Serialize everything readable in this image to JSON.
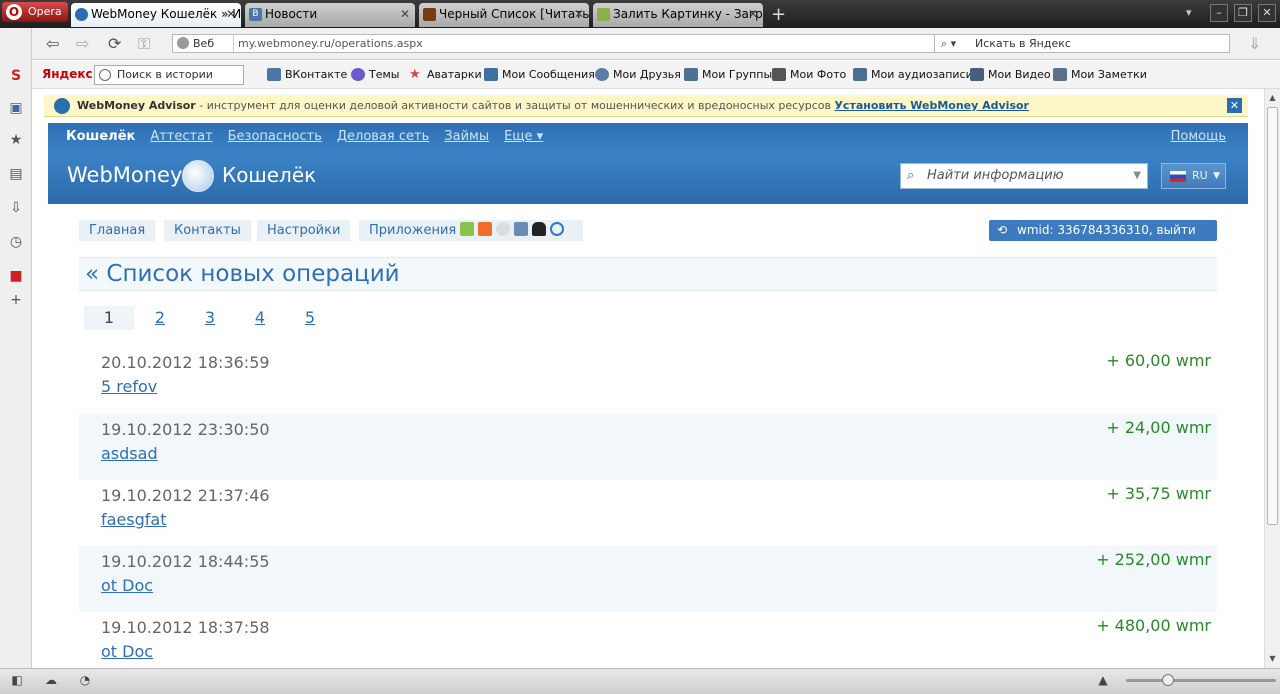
{
  "browser": {
    "opera_label": "Opera",
    "tabs": [
      {
        "label": "WebMoney Кошелёк » И...",
        "active": true
      },
      {
        "label": "Новости",
        "active": false
      },
      {
        "label": "Черный Список [Читать...",
        "active": false
      },
      {
        "label": "Залить Картинку - Загр...",
        "active": false
      }
    ],
    "close_glyph": "✕",
    "newtab_glyph": "+",
    "address": {
      "prefix": "Веб",
      "url": "my.webmoney.ru/operations.aspx"
    },
    "search_placeholder": "Искать в Яндекс",
    "yandex": "Яндекс",
    "history_placeholder": "Поиск в истории",
    "bookmarks": [
      "ВКонтакте",
      "Темы",
      "Аватарки",
      "Мои Сообщения",
      "Мои Друзья",
      "Мои Группы",
      "Мои Фото",
      "Мои аудиозаписи",
      "Мои Видео",
      "Мои Заметки"
    ]
  },
  "advisor": {
    "brand": "WebMoney Advisor",
    "text": " - инструмент для оценки деловой активности сайтов и защиты от мошеннических и вредоносных ресурсов ",
    "link": "Установить WebMoney Advisor",
    "close": "✕"
  },
  "header": {
    "nav": [
      "Кошелёк",
      "Аттестат",
      "Безопасность",
      "Деловая сеть",
      "Займы",
      "Еще ▾"
    ],
    "help": "Помощь",
    "brand": "WebMoney",
    "brand_sub": "Кошелёк",
    "search_placeholder": "Найти информацию",
    "lang": "RU"
  },
  "menu": {
    "items": [
      "Главная",
      "Контакты",
      "Настройки",
      "Приложения"
    ],
    "wmid": "wmid: 336784336310, выйти"
  },
  "page_title": "« Список новых операций",
  "pager": [
    "1",
    "2",
    "3",
    "4",
    "5"
  ],
  "operations": [
    {
      "date": "20.10.2012 18:36:59",
      "desc": "5 refov",
      "amount": "+ 60,00 wmr"
    },
    {
      "date": "19.10.2012 23:30:50",
      "desc": "asdsad",
      "amount": "+ 24,00 wmr"
    },
    {
      "date": "19.10.2012 21:37:46",
      "desc": "faesgfat",
      "amount": "+ 35,75 wmr"
    },
    {
      "date": "19.10.2012 18:44:55",
      "desc": "ot Doc",
      "amount": "+ 252,00 wmr"
    },
    {
      "date": "19.10.2012 18:37:58",
      "desc": "ot Doc",
      "amount": "+ 480,00 wmr"
    }
  ],
  "colors": {
    "brand_blue": "#2f6fb3",
    "amount_green": "#2a8a2a",
    "advisor_bg": "#fdf6c6"
  }
}
